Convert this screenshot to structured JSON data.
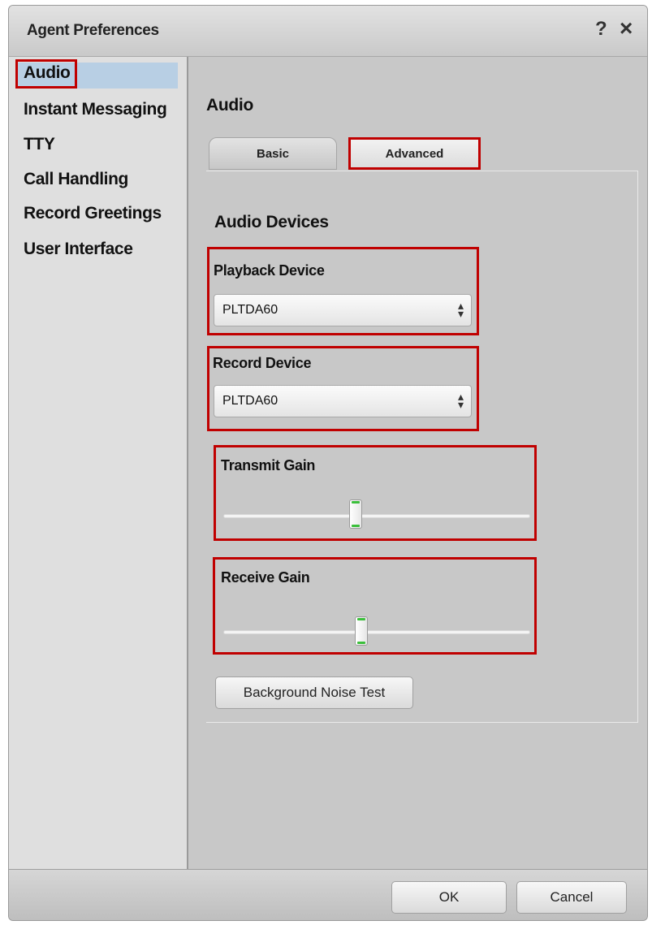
{
  "window": {
    "title": "Agent Preferences",
    "help_icon": "?",
    "close_icon": "×"
  },
  "sidebar": {
    "items": [
      {
        "label": "Audio",
        "selected": true
      },
      {
        "label": "Instant Messaging"
      },
      {
        "label": "TTY"
      },
      {
        "label": "Call Handling"
      },
      {
        "label": "Record Greetings"
      },
      {
        "label": "User Interface"
      }
    ]
  },
  "content": {
    "section_title": "Audio",
    "tabs": [
      {
        "label": "Basic",
        "active": false
      },
      {
        "label": "Advanced",
        "active": true
      }
    ],
    "devices_title": "Audio Devices",
    "playback": {
      "label": "Playback Device",
      "value": "PLTDA60"
    },
    "record": {
      "label": "Record Device",
      "value": "PLTDA60"
    },
    "transmit_gain": {
      "label": "Transmit Gain",
      "level": 0.43
    },
    "receive_gain": {
      "label": "Receive Gain",
      "level": 0.45
    },
    "noise_test_label": "Background Noise Test"
  },
  "footer": {
    "ok_label": "OK",
    "cancel_label": "Cancel"
  },
  "colors": {
    "highlight": "#c00000",
    "selection": "#b8cfe4",
    "thumb_accent": "#3bbf3b"
  }
}
